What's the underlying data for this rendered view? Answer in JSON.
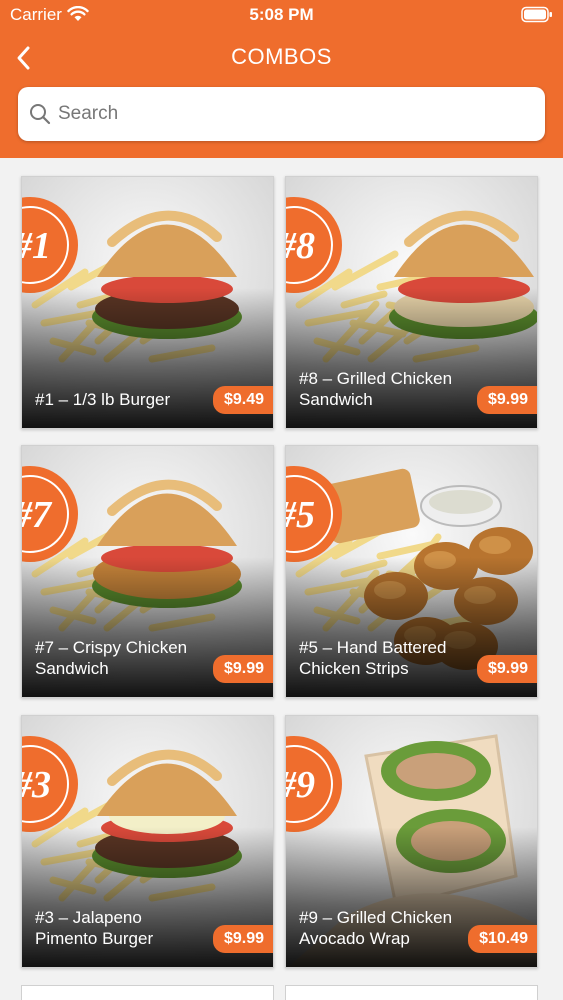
{
  "status_bar": {
    "carrier": "Carrier",
    "time": "5:08 PM"
  },
  "nav": {
    "title": "COMBOS"
  },
  "search": {
    "placeholder": "Search",
    "value": ""
  },
  "combos": [
    {
      "number": "1",
      "name": "#1 – 1/3 lb Burger",
      "price": "$9.49",
      "food": "burger"
    },
    {
      "number": "8",
      "name": "#8 – Grilled Chicken Sandwich",
      "price": "$9.99",
      "food": "chicken-sandwich"
    },
    {
      "number": "7",
      "name": "#7 – Crispy Chicken Sandwich",
      "price": "$9.99",
      "food": "crispy-sandwich"
    },
    {
      "number": "5",
      "name": "#5 – Hand Battered Chicken Strips",
      "price": "$9.99",
      "food": "chicken-strips"
    },
    {
      "number": "3",
      "name": "#3 – Jalapeno Pimento Burger",
      "price": "$9.99",
      "food": "jalapeno-burger"
    },
    {
      "number": "9",
      "name": "#9 – Grilled Chicken Avocado Wrap",
      "price": "$10.49",
      "food": "wrap"
    }
  ],
  "colors": {
    "brand": "#ef6d2d",
    "background": "#f2f2f2"
  }
}
